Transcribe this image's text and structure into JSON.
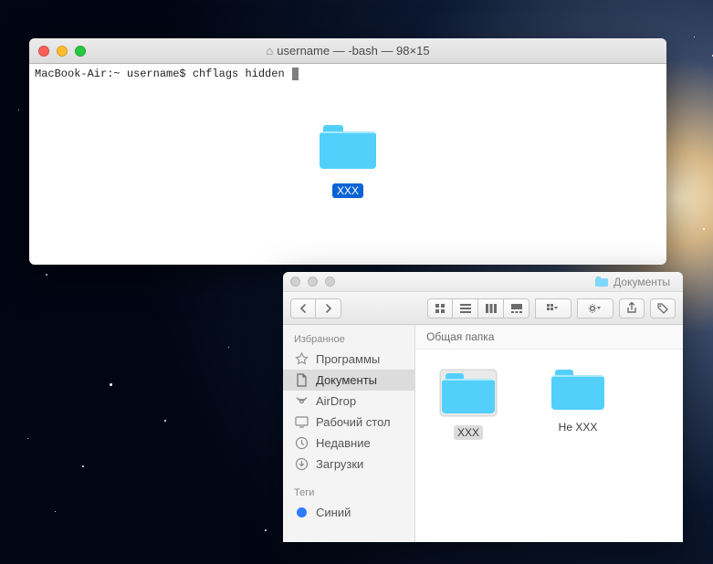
{
  "terminal": {
    "title": "username — -bash — 98×15",
    "prompt": "MacBook-Air:~ username$ ",
    "command": "chflags hidden ",
    "folder_label": "XXX"
  },
  "finder": {
    "title": "Документы",
    "path_header": "Общая папка",
    "sidebar": {
      "favorites_header": "Избранное",
      "items": [
        {
          "icon": "apps",
          "label": "Программы"
        },
        {
          "icon": "doc",
          "label": "Документы"
        },
        {
          "icon": "airdrop",
          "label": "AirDrop"
        },
        {
          "icon": "desktop",
          "label": "Рабочий стол"
        },
        {
          "icon": "recent",
          "label": "Недавние"
        },
        {
          "icon": "download",
          "label": "Загрузки"
        }
      ],
      "tags_header": "Теги",
      "tags": [
        {
          "color": "#2f7bff",
          "label": "Синий"
        }
      ]
    },
    "content": {
      "items": [
        {
          "label": "XXX",
          "selected": true
        },
        {
          "label": "Не XXX",
          "selected": false
        }
      ]
    }
  }
}
